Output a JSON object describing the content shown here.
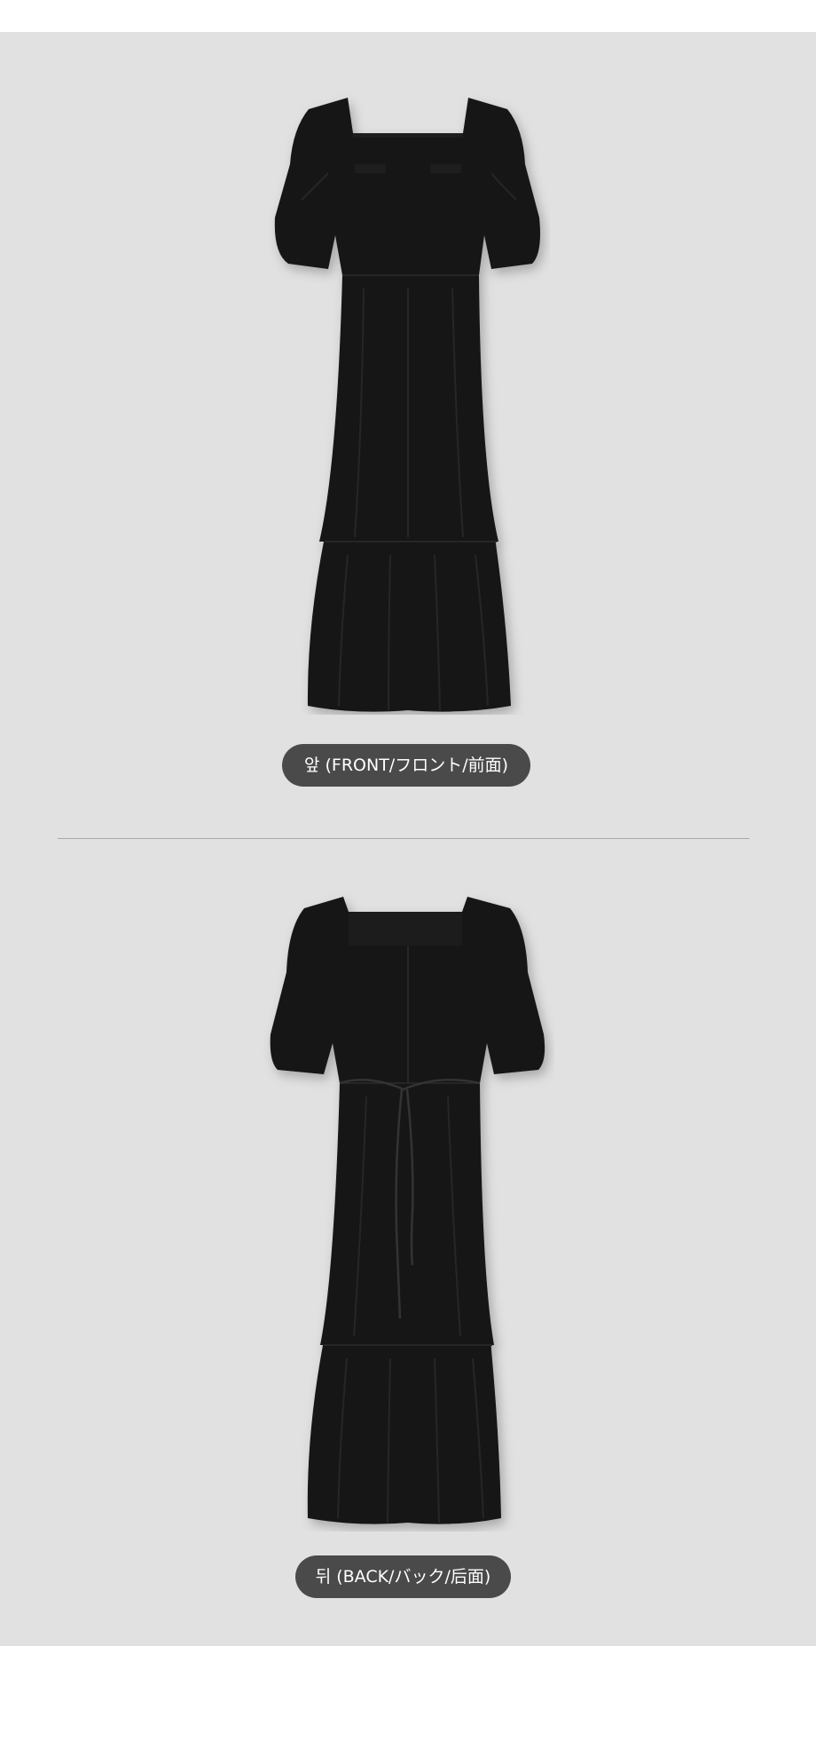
{
  "labels": {
    "front": "앞 (FRONT/フロント/前面)",
    "back": "뒤 (BACK/バック/后面)"
  },
  "images": {
    "front": "black-dress-front-photo",
    "back": "black-dress-back-photo"
  },
  "colors": {
    "background": "#e1e1e1",
    "dress": "#141414",
    "pill": "#4a4a4a",
    "pill_text": "#ffffff",
    "divider": "#a9a9a9"
  }
}
